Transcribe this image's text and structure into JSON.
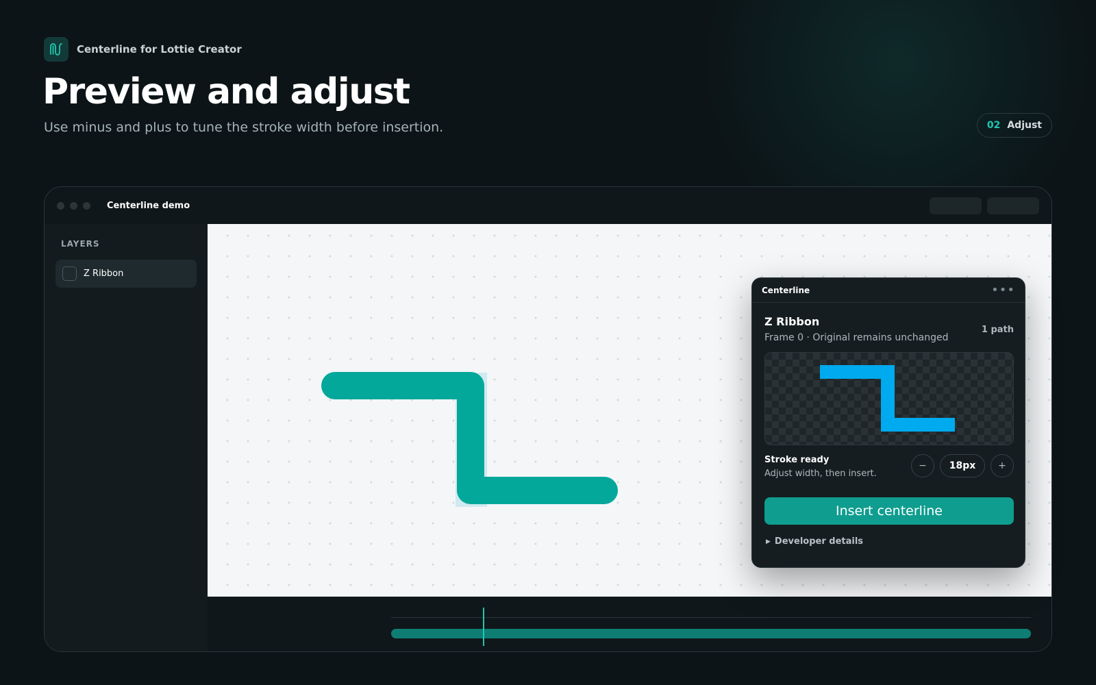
{
  "brand": {
    "name": "Centerline for Lottie Creator",
    "logo_icon": "waveform-icon"
  },
  "header": {
    "title": "Preview and adjust",
    "subtitle": "Use minus and plus to tune the stroke width before insertion.",
    "step_number": "02",
    "step_label": "Adjust"
  },
  "window": {
    "title": "Centerline demo"
  },
  "sidebar": {
    "heading": "LAYERS",
    "items": [
      {
        "label": "Z Ribbon"
      }
    ]
  },
  "panel": {
    "title": "Centerline",
    "layer_name": "Z Ribbon",
    "layer_meta": "Frame 0 · Original remains unchanged",
    "path_count": "1 path",
    "status_title": "Stroke ready",
    "status_subtitle": "Adjust width, then insert.",
    "decrease_label": "−",
    "increase_label": "+",
    "stroke_width": "18px",
    "insert_label": "Insert centerline",
    "developer_label": "Developer details"
  },
  "colors": {
    "accent": "#1fc7b1",
    "shape_fill": "#04a89a",
    "preview_stroke": "#00aaee",
    "insert_button": "#0f9d8f"
  },
  "timeline": {
    "playhead_position": 0.144
  }
}
